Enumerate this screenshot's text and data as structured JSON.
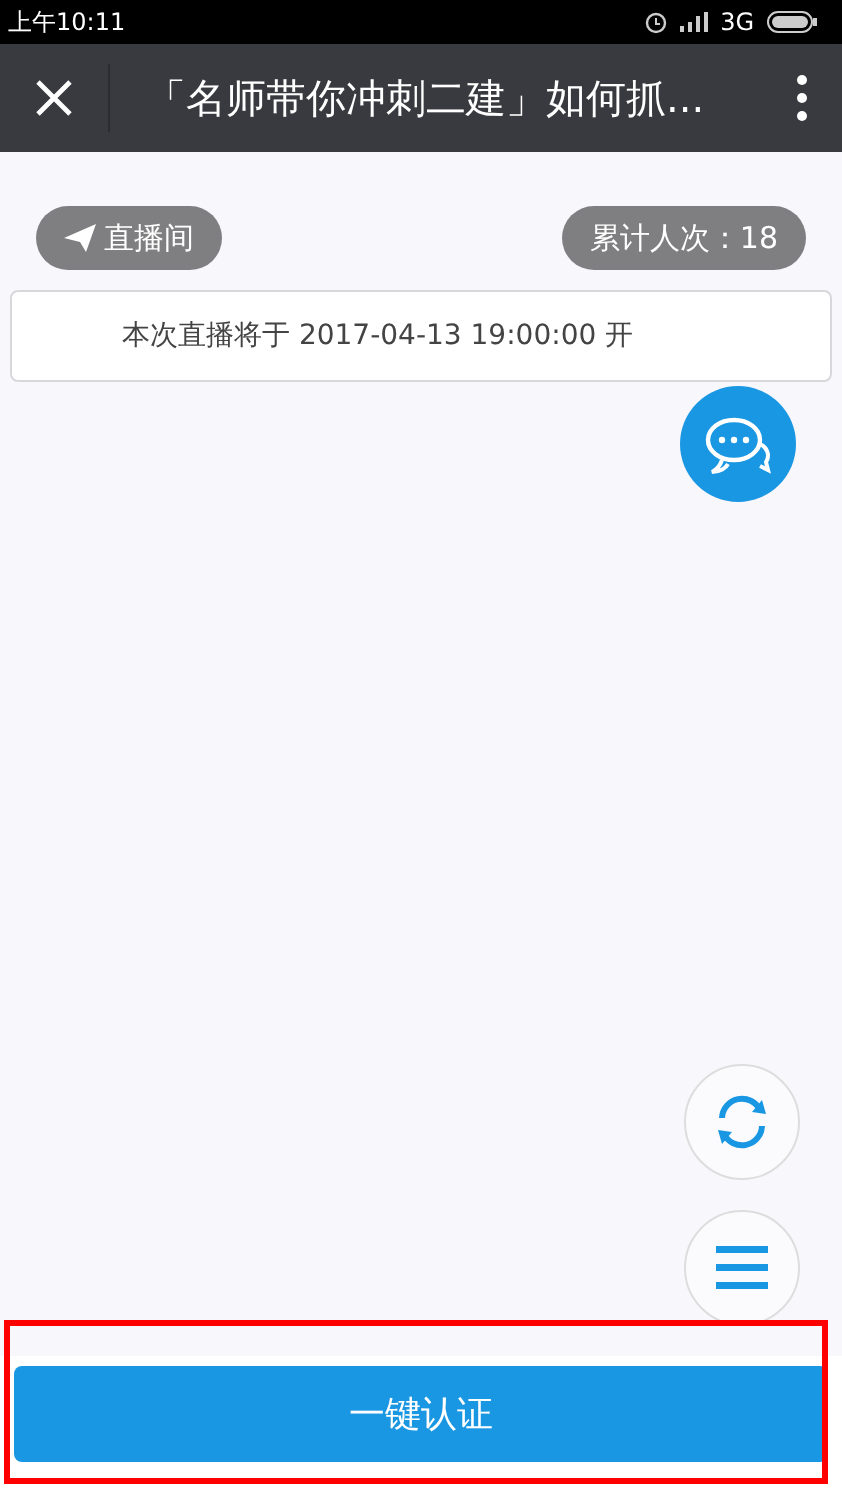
{
  "status_bar": {
    "time": "上午10:11",
    "network": "3G"
  },
  "title_bar": {
    "title": "「名师带你冲刺二建」如何抓..."
  },
  "live_room_button": {
    "label": "直播间"
  },
  "viewer_count": {
    "label": "累计人次：18"
  },
  "notice": {
    "text": "本次直播将于 2017-04-13 19:00:00 开"
  },
  "bottom_button": {
    "label": "一键认证",
    "highlighted": true
  }
}
